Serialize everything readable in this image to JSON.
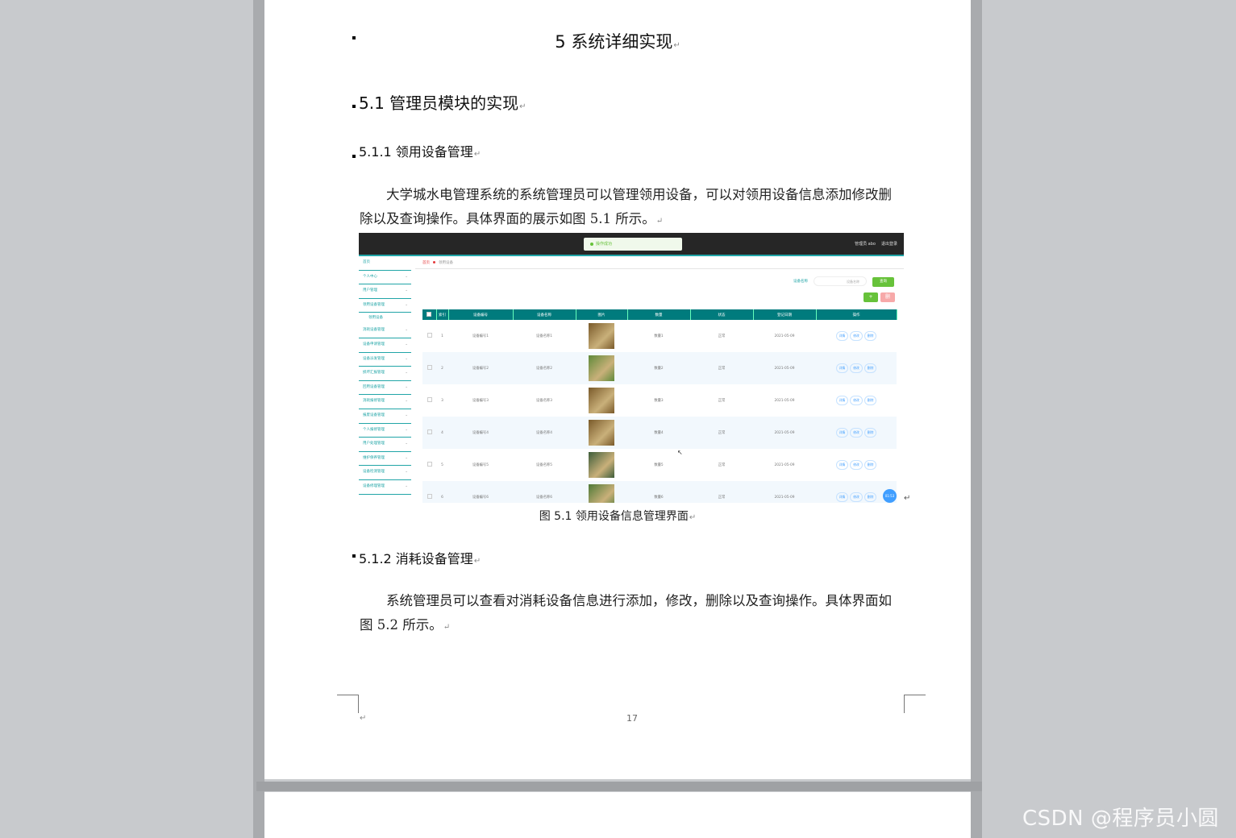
{
  "document": {
    "chapter_title": "5 系统详细实现",
    "section_title": "5.1 管理员模块的实现",
    "subsection1_title": "5.1.1 领用设备管理",
    "paragraph1": "大学城水电管理系统的系统管理员可以管理领用设备，可以对领用设备信息添加修改删除以及查询操作。具体界面的展示如图 5.1 所示。",
    "figure_caption": "图 5.1  领用设备信息管理界面",
    "subsection2_title": "5.1.2 消耗设备管理",
    "paragraph2": "系统管理员可以查看对消耗设备信息进行添加，修改，删除以及查询操作。具体界面如图 5.2 所示。",
    "page_number": "17",
    "return_mark": "↵"
  },
  "screenshot": {
    "toast": "操作成功",
    "user_label": "管理员 abo",
    "logout": "退出登录",
    "sidebar": [
      {
        "label": "首页",
        "icon": "home-icon"
      },
      {
        "label": "个人中心",
        "icon": "user-icon"
      },
      {
        "label": "用户管理",
        "icon": "users-icon"
      },
      {
        "label": "领用设备管理",
        "icon": "device-icon"
      },
      {
        "label": "领用设备",
        "sub": true
      },
      {
        "label": "消耗设备管理",
        "icon": "box-icon"
      },
      {
        "label": "设备申请管理",
        "icon": "apply-icon"
      },
      {
        "label": "设备派发管理",
        "icon": "send-icon"
      },
      {
        "label": "损坏汇报管理",
        "icon": "report-icon"
      },
      {
        "label": "回用设备管理",
        "icon": "recycle-icon"
      },
      {
        "label": "消耗报修管理",
        "icon": "repair-icon"
      },
      {
        "label": "报废设备管理",
        "icon": "scrap-icon"
      },
      {
        "label": "个人报修管理",
        "icon": "personal-icon"
      },
      {
        "label": "用户处理管理",
        "icon": "handle-icon"
      },
      {
        "label": "维护保养管理",
        "icon": "maintain-icon"
      },
      {
        "label": "设备检测管理",
        "icon": "check-icon"
      },
      {
        "label": "设备修理管理",
        "icon": "fix-icon"
      }
    ],
    "breadcrumb": [
      "首页",
      "领用设备"
    ],
    "search_label": "设备名称",
    "search_placeholder": "设备名称",
    "search_button": "查询",
    "add_button": "+",
    "delete_button": "删",
    "columns": [
      "",
      "索引",
      "设备编号",
      "设备名称",
      "图片",
      "数量",
      "状态",
      "登记日期",
      "操作"
    ],
    "rows": [
      {
        "idx": "1",
        "code": "设备编号1",
        "name": "设备名称1",
        "qty": "数量1",
        "status": "正常",
        "date": "2021-05-09",
        "img": "#7a5a2a"
      },
      {
        "idx": "2",
        "code": "设备编号2",
        "name": "设备名称2",
        "qty": "数量2",
        "status": "正常",
        "date": "2021-05-09",
        "img": "#5f8a3a"
      },
      {
        "idx": "3",
        "code": "设备编号3",
        "name": "设备名称3",
        "qty": "数量3",
        "status": "正常",
        "date": "2021-05-09",
        "img": "#7a5a2a"
      },
      {
        "idx": "4",
        "code": "设备编号4",
        "name": "设备名称4",
        "qty": "数量4",
        "status": "正常",
        "date": "2021-05-09",
        "img": "#7a5a2a"
      },
      {
        "idx": "5",
        "code": "设备编号5",
        "name": "设备名称5",
        "qty": "数量5",
        "status": "正常",
        "date": "2021-05-09",
        "img": "#3e5d3a"
      },
      {
        "idx": "6",
        "code": "设备编号6",
        "name": "设备名称6",
        "qty": "数量6",
        "status": "正常",
        "date": "2021-05-09",
        "img": "#4f7a38"
      }
    ],
    "ops": [
      "详情",
      "修改",
      "删除"
    ],
    "badge": "01:53"
  },
  "watermark": "CSDN @程序员小圆"
}
